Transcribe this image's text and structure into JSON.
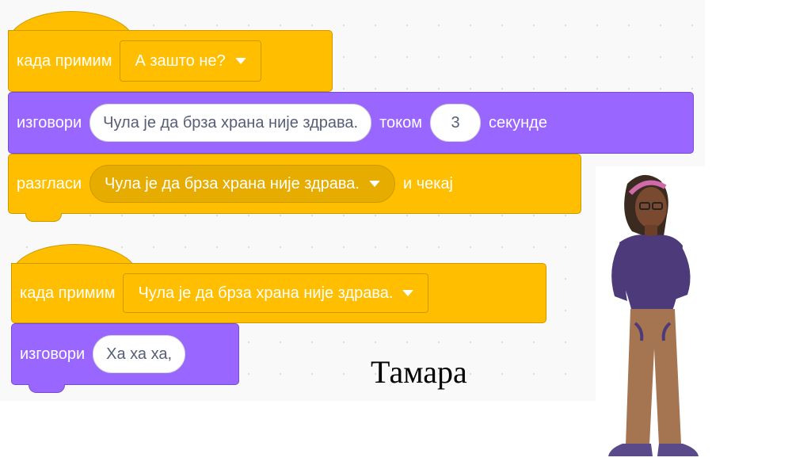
{
  "script1": {
    "hat": {
      "label": "када примим",
      "dropdown": "А зашто не?"
    },
    "say": {
      "label": "изговори",
      "message": "Чула је да брза храна није здрава.",
      "for": "током",
      "secs": "3",
      "unit": "секунде"
    },
    "broadcast": {
      "label": "разгласи",
      "dropdown": "Чула је да брза храна није здрава.",
      "suffix": "и чекај"
    }
  },
  "script2": {
    "hat": {
      "label": "када примим",
      "dropdown": "Чула је да брза храна није здрава."
    },
    "say": {
      "label": "изговори",
      "message": "Ха ха ха,"
    }
  },
  "character_name": "Тамара",
  "colors": {
    "events": "#ffbf00",
    "looks": "#9966ff",
    "stage_bg": "#f9f9f9"
  }
}
